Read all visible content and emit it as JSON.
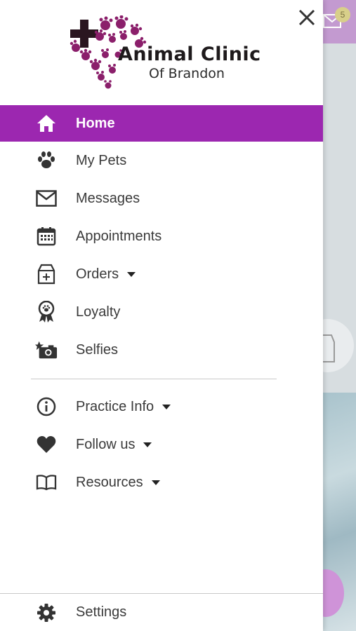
{
  "app": {
    "logo_title": "Animal Clinic",
    "logo_subtitle": "Of Brandon",
    "brand_color": "#9c27b0",
    "logo_color": "#8b1f6b"
  },
  "menu": {
    "items": [
      {
        "label": "Home",
        "icon": "home-icon",
        "active": true
      },
      {
        "label": "My Pets",
        "icon": "paw-icon"
      },
      {
        "label": "Messages",
        "icon": "envelope-icon"
      },
      {
        "label": "Appointments",
        "icon": "calendar-icon"
      },
      {
        "label": "Orders",
        "icon": "food-bag-icon",
        "expandable": true
      },
      {
        "label": "Loyalty",
        "icon": "award-ribbon-icon"
      },
      {
        "label": "Selfies",
        "icon": "camera-icon"
      }
    ],
    "secondary": [
      {
        "label": "Practice Info",
        "icon": "info-icon",
        "expandable": true
      },
      {
        "label": "Follow us",
        "icon": "heart-icon",
        "expandable": true
      },
      {
        "label": "Resources",
        "icon": "book-icon",
        "expandable": true
      }
    ],
    "settings_label": "Settings",
    "settings_icon": "gear-icon"
  },
  "background": {
    "messages_badge": "5"
  }
}
